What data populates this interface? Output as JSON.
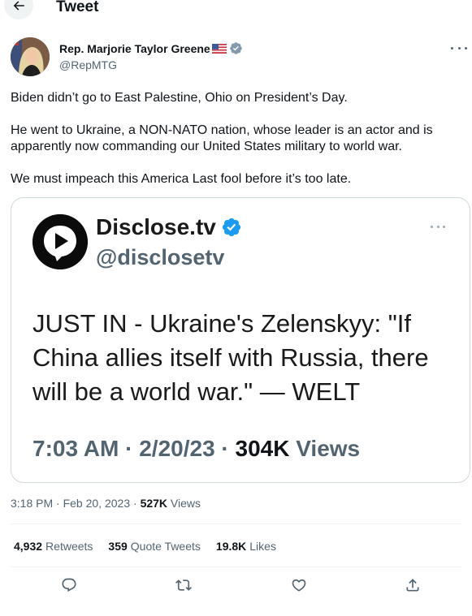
{
  "header": {
    "title": "Tweet",
    "back_icon": "arrow-left-icon"
  },
  "author": {
    "name": "Rep. Marjorie Taylor Greene",
    "handle": "@RepMTG",
    "flag_icon": "us-flag-icon",
    "verified_icon": "verified-badge-icon",
    "verified_color": "#829aab"
  },
  "tweet": {
    "paragraphs": [
      "Biden didn’t go to East Palestine, Ohio on President’s Day.",
      "He went to Ukraine, a NON-NATO nation, whose leader is an actor and is apparently now commanding our United States military to world war.",
      "We must impeach this America Last fool before it’s too late."
    ]
  },
  "quoted": {
    "name": "Disclose.tv",
    "handle": "@disclosetv",
    "verified_color": "#1d9bf0",
    "text": "JUST IN - Ukraine's Zelenskyy: \"If China allies itself with Russia, there will be a world war.\" — WELT",
    "time": "7:03 AM",
    "date": "2/20/23",
    "views_count": "304K",
    "views_label": "Views",
    "separator": "·"
  },
  "meta": {
    "time": "3:18 PM",
    "date": "Feb 20, 2023",
    "views_count": "527K",
    "views_label": "Views",
    "separator": "·"
  },
  "stats": [
    {
      "count": "4,932",
      "label": "Retweets"
    },
    {
      "count": "359",
      "label": "Quote Tweets"
    },
    {
      "count": "19.8K",
      "label": "Likes"
    }
  ],
  "actions": [
    {
      "name": "reply",
      "icon": "reply-icon"
    },
    {
      "name": "retweet",
      "icon": "retweet-icon"
    },
    {
      "name": "like",
      "icon": "heart-icon"
    },
    {
      "name": "share",
      "icon": "share-icon"
    }
  ]
}
